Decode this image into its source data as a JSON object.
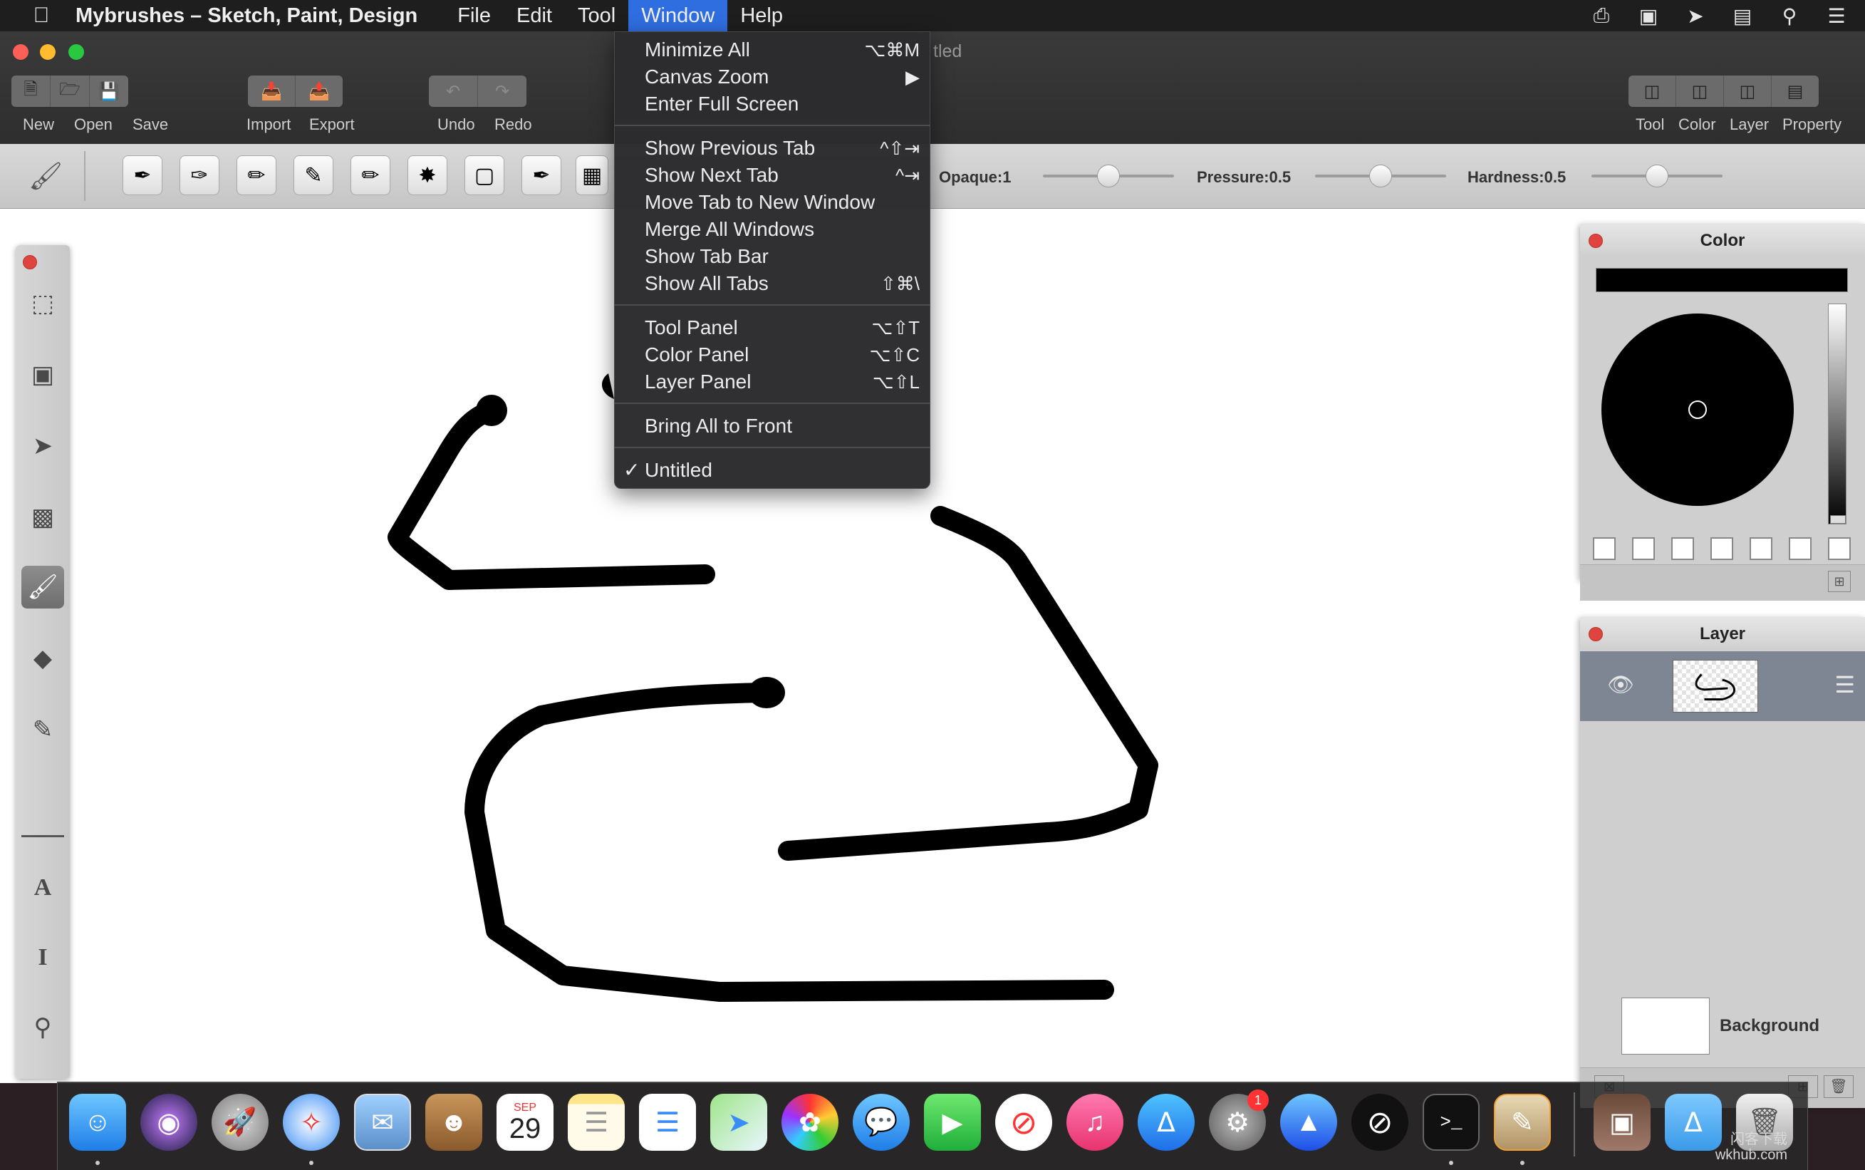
{
  "menubar": {
    "apple": "",
    "app_name": "Mybrushes – Sketch, Paint, Design",
    "items": [
      "File",
      "Edit",
      "Tool",
      "Window",
      "Help"
    ],
    "active_item": "Window"
  },
  "window": {
    "title_fragment": "tled",
    "toolbar": {
      "new": "New",
      "open": "Open",
      "save": "Save",
      "import": "Import",
      "export": "Export",
      "undo": "Undo",
      "redo": "Redo",
      "tool": "Tool",
      "color": "Color",
      "layer": "Layer",
      "property": "Property"
    },
    "brushbar": {
      "opaque": "Opaque:1",
      "pressure": "Pressure:0.5",
      "hardness": "Hardness:0.5",
      "opaque_value": 0.5,
      "pressure_value": 0.5,
      "hardness_value": 0.5
    }
  },
  "window_menu": {
    "items": [
      {
        "label": "Minimize All",
        "shortcut": "⌥⌘M"
      },
      {
        "label": "Canvas Zoom",
        "shortcut": "▶"
      },
      {
        "label": "Enter Full Screen",
        "shortcut": ""
      },
      {
        "label": "Show Previous Tab",
        "shortcut": "^⇧⇥"
      },
      {
        "label": "Show Next Tab",
        "shortcut": "^⇥"
      },
      {
        "label": "Move Tab to New Window",
        "shortcut": ""
      },
      {
        "label": "Merge All Windows",
        "shortcut": ""
      },
      {
        "label": "Show Tab Bar",
        "shortcut": ""
      },
      {
        "label": "Show All Tabs",
        "shortcut": "⇧⌘\\"
      },
      {
        "label": "Tool Panel",
        "shortcut": "⌥⇧T"
      },
      {
        "label": "Color Panel",
        "shortcut": "⌥⇧C"
      },
      {
        "label": "Layer Panel",
        "shortcut": "⌥⇧L"
      },
      {
        "label": "Bring All to Front",
        "shortcut": ""
      },
      {
        "label": "Untitled",
        "shortcut": "",
        "checked": true
      }
    ]
  },
  "panels": {
    "color": {
      "title": "Color",
      "current_color": "#000000"
    },
    "layer": {
      "title": "Layer",
      "background_label": "Background"
    }
  },
  "dock": {
    "calendar_month": "SEP",
    "calendar_day": "29",
    "badge_count": "1"
  },
  "watermark": {
    "line1": "闪客下载",
    "line2": "wkhub.com"
  }
}
